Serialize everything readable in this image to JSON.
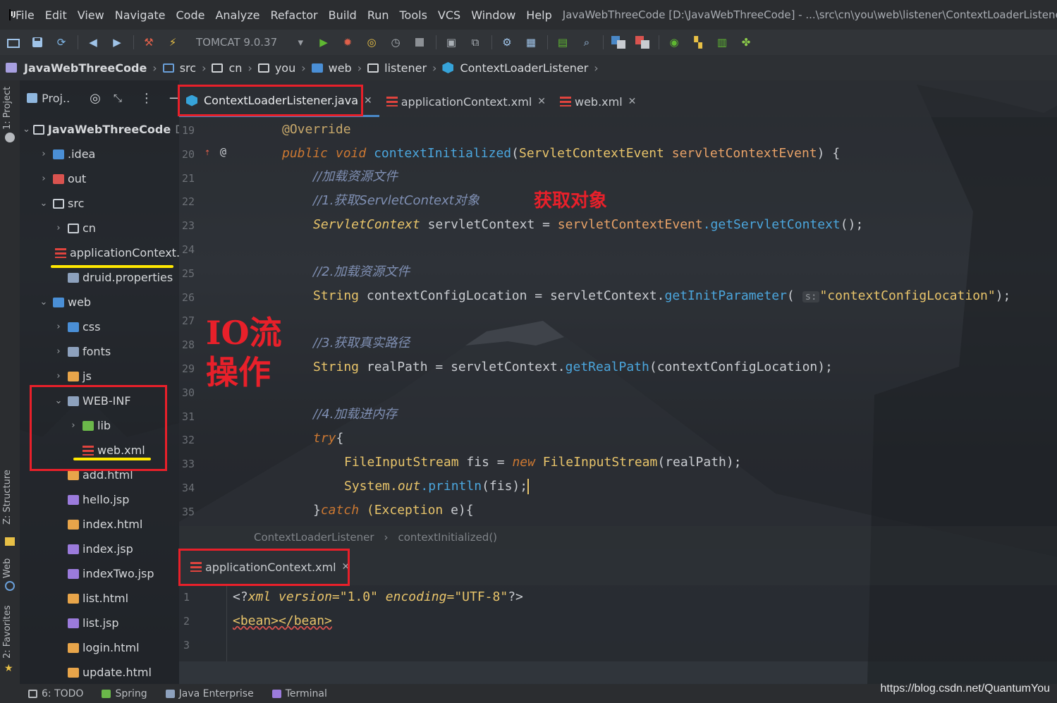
{
  "menubar": {
    "items": [
      "File",
      "Edit",
      "View",
      "Navigate",
      "Code",
      "Analyze",
      "Refactor",
      "Build",
      "Run",
      "Tools",
      "VCS",
      "Window",
      "Help"
    ],
    "window_title": "JavaWebThreeCode [D:\\JavaWebThreeCode] - ...\\src\\cn\\you\\web\\listener\\ContextLoaderListener.j"
  },
  "toolbar": {
    "run_config": "TOMCAT 9.0.37",
    "run_config_dropdown_icon": "chevron-down-icon",
    "icons": [
      "open-folder-icon",
      "save-icon",
      "sync-icon",
      "back-icon",
      "forward-icon",
      "build-hammer-icon",
      "run-config-icon",
      "run-icon",
      "debug-icon",
      "coverage-icon",
      "profile-icon",
      "stop-icon",
      "attach-icon",
      "deploy-icon",
      "settings-icon",
      "structure-icon",
      "terminal-icon",
      "search-icon",
      "translate-icon",
      "translate-alt-icon",
      "vcs-icon",
      "layout-icon",
      "diagram-icon",
      "plugin-icon"
    ]
  },
  "breadcrumb": {
    "items": [
      "JavaWebThreeCode",
      "src",
      "cn",
      "you",
      "web",
      "listener",
      "ContextLoaderListener"
    ]
  },
  "left_stripe": {
    "project": "1: Project",
    "structure": "Z: Structure",
    "web": "Web",
    "favorites": "2: Favorites"
  },
  "project_panel": {
    "selector": "Proj..",
    "root": "JavaWebThreeCode",
    "root_path": "D:",
    "tree": [
      {
        "label": ".idea",
        "indent": 1,
        "chev": "›",
        "icon": "blue"
      },
      {
        "label": "out",
        "indent": 1,
        "chev": "›",
        "icon": "red"
      },
      {
        "label": "src",
        "indent": 1,
        "chev": "⌄",
        "icon": "folder"
      },
      {
        "label": "cn",
        "indent": 2,
        "chev": "›",
        "icon": "folder"
      },
      {
        "label": "applicationContext.xml",
        "indent": 2,
        "chev": "",
        "icon": "xml"
      },
      {
        "label": "druid.properties",
        "indent": 2,
        "chev": "",
        "icon": "grey"
      },
      {
        "label": "web",
        "indent": 1,
        "chev": "⌄",
        "icon": "blue"
      },
      {
        "label": "css",
        "indent": 2,
        "chev": "›",
        "icon": "blue"
      },
      {
        "label": "fonts",
        "indent": 2,
        "chev": "›",
        "icon": "grey"
      },
      {
        "label": "js",
        "indent": 2,
        "chev": "›",
        "icon": "html"
      },
      {
        "label": "WEB-INF",
        "indent": 2,
        "chev": "⌄",
        "icon": "grey"
      },
      {
        "label": "lib",
        "indent": 3,
        "chev": "›",
        "icon": "green"
      },
      {
        "label": "web.xml",
        "indent": 3,
        "chev": "",
        "icon": "xml"
      },
      {
        "label": "add.html",
        "indent": 2,
        "chev": "",
        "icon": "html"
      },
      {
        "label": "hello.jsp",
        "indent": 2,
        "chev": "",
        "icon": "jsp"
      },
      {
        "label": "index.html",
        "indent": 2,
        "chev": "",
        "icon": "html"
      },
      {
        "label": "index.jsp",
        "indent": 2,
        "chev": "",
        "icon": "jsp"
      },
      {
        "label": "indexTwo.jsp",
        "indent": 2,
        "chev": "",
        "icon": "jsp"
      },
      {
        "label": "list.html",
        "indent": 2,
        "chev": "",
        "icon": "html"
      },
      {
        "label": "list.jsp",
        "indent": 2,
        "chev": "",
        "icon": "jsp"
      },
      {
        "label": "login.html",
        "indent": 2,
        "chev": "",
        "icon": "html"
      },
      {
        "label": "update.html",
        "indent": 2,
        "chev": "",
        "icon": "html"
      }
    ]
  },
  "editor_tabs": [
    {
      "label": "ContextLoaderListener.java",
      "active": true
    },
    {
      "label": "applicationContext.xml",
      "active": false
    },
    {
      "label": "web.xml",
      "active": false
    }
  ],
  "editor": {
    "line_numbers": [
      "19",
      "20",
      "21",
      "22",
      "23",
      "24",
      "25",
      "26",
      "27",
      "28",
      "29",
      "30",
      "31",
      "32",
      "33",
      "34",
      "35"
    ],
    "lines": {
      "l19": "@Override",
      "l20_kw": "public void",
      "l20_fn": "contextInitialized",
      "l20_type": "ServletContextEvent",
      "l20_param": "servletContextEvent",
      "l20_end": ") {",
      "l21": "//加载资源文件",
      "l22": "//1.获取ServletContext对象",
      "l23_type": "ServletContext",
      "l23_var": "servletContext =",
      "l23_obj": "servletContextEvent",
      "l23_fn": ".getServletContext",
      "l23_end": "();",
      "l25": "//2.加载资源文件",
      "l26_type": "String",
      "l26_var": "contextConfigLocation = servletContext.",
      "l26_fn": "getInitParameter",
      "l26_hint": "s:",
      "l26_str": "\"contextConfigLocation\"",
      "l26_end": ");",
      "l28": "//3.获取真实路径",
      "l29_type": "String",
      "l29_var": "realPath = servletContext.",
      "l29_fn": "getRealPath",
      "l29_end": "(contextConfigLocation);",
      "l31": "//4.加载进内存",
      "l32_kw": "try",
      "l32_end": "{",
      "l33_type": "FileInputStream",
      "l33_var": "fis =",
      "l33_kw": "new",
      "l33_type2": "FileInputStream",
      "l33_end": "(realPath);",
      "l34_sys": "System.",
      "l34_out": "out",
      "l34_fn": ".println",
      "l34_end": "(fis);",
      "l35_open": "}",
      "l35_kw": "catch",
      "l35_type": " (Exception",
      "l35_end": " e){"
    },
    "override_badge": "@"
  },
  "editor_breadcrumbs": {
    "class": "ContextLoaderListener",
    "method": "contextInitialized()"
  },
  "bottom_editor": {
    "tab_label": "applicationContext.xml",
    "line_numbers": [
      "1",
      "2",
      "3"
    ],
    "xml_open": "<?",
    "xml_name": "xml",
    "xml_version_attr": "version",
    "xml_version_val": "=\"1.0\"",
    "xml_encoding_attr": "encoding",
    "xml_encoding_val": "=\"UTF-8\"",
    "xml_close": "?>",
    "line2": "<bean></bean>"
  },
  "statusbar": {
    "items": [
      "6: TODO",
      "Spring",
      "Java Enterprise",
      "Terminal"
    ]
  },
  "annotations": {
    "get_object": "获取对象",
    "io_line1": "IO流",
    "io_line2": "操作"
  },
  "watermark": "https://blog.csdn.net/QuantumYou"
}
